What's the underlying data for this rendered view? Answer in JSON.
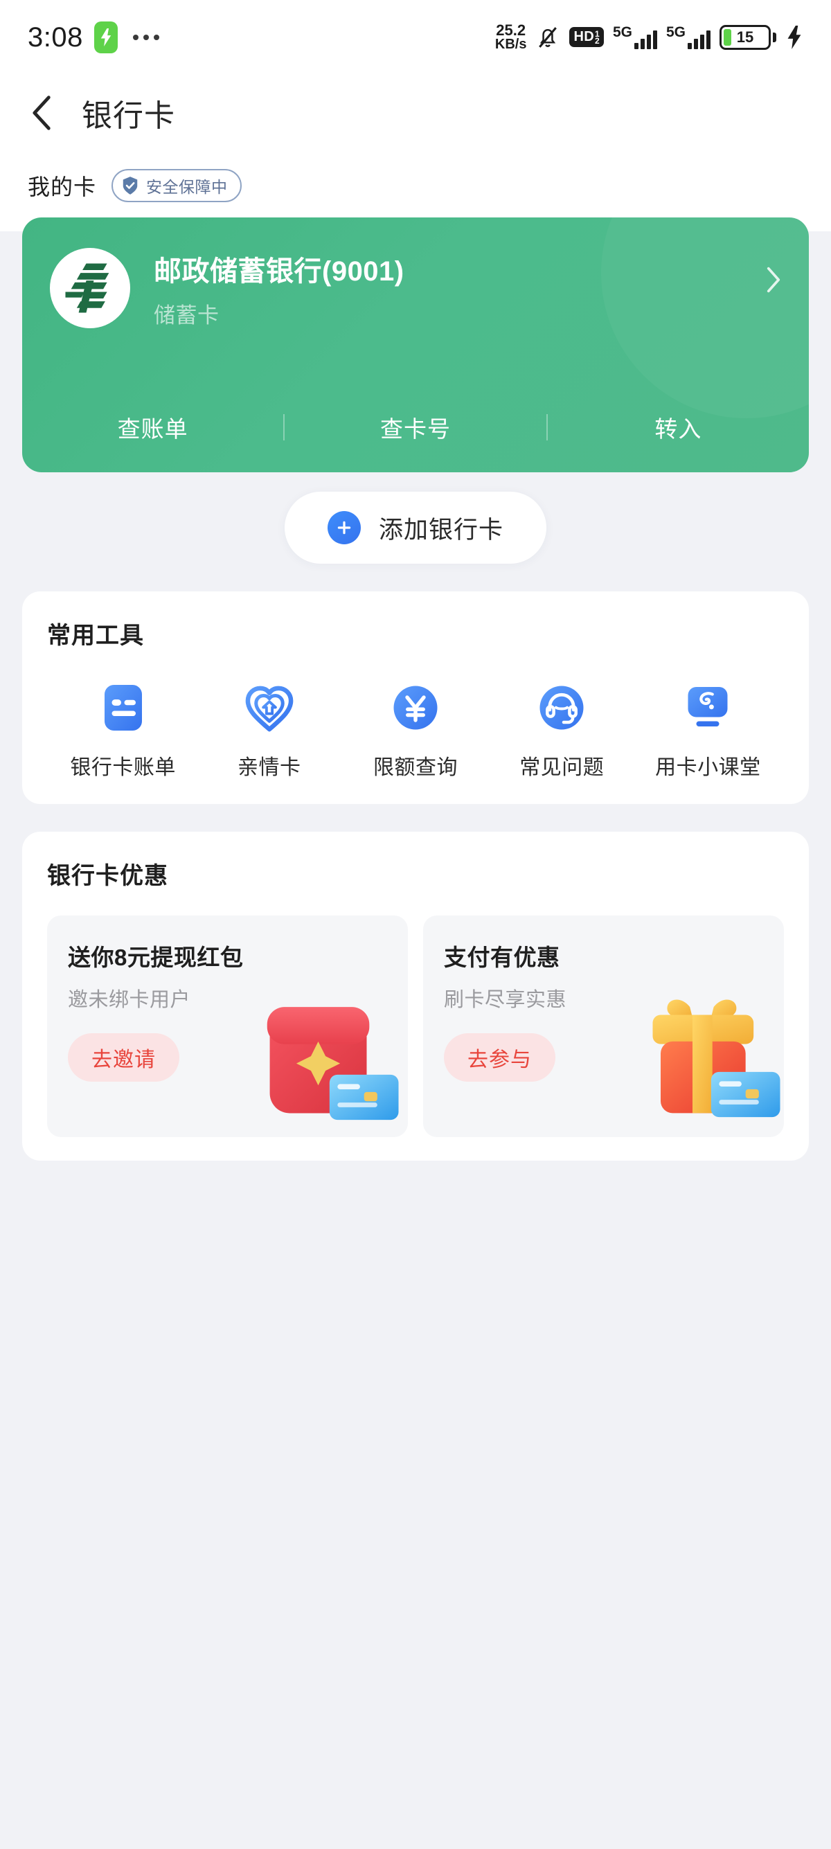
{
  "status_bar": {
    "time": "3:08",
    "charging_icon": "bolt-pill-icon",
    "more_icon": "more-dots-icon",
    "net_speed_value": "25.2",
    "net_speed_unit": "KB/s",
    "mute_icon": "bell-muted-icon",
    "volte_badge": "HD",
    "volte_sub": "1",
    "volte_sub2": "2",
    "sim1_network": "5G",
    "sim2_network": "5G",
    "battery_level": "15",
    "battery_charging_icon": "bolt-icon",
    "battery_color": "#5ed249"
  },
  "nav": {
    "back_icon": "chevron-left-icon",
    "title": "银行卡"
  },
  "my_cards": {
    "title": "我的卡",
    "badge_text": "安全保障中",
    "badge_icon": "shield-check-icon",
    "badge_color": "#5f7296"
  },
  "bank_card": {
    "bank_name": "邮政储蓄银行(9001)",
    "card_type": "储蓄卡",
    "logo_icon": "china-post-savings-bank-logo",
    "chevron_icon": "chevron-right-icon",
    "accent_color": "#4cbb8c",
    "actions": [
      {
        "label": "查账单"
      },
      {
        "label": "查卡号"
      },
      {
        "label": "转入"
      }
    ]
  },
  "add_card": {
    "label": "添加银行卡",
    "icon": "plus-circle-icon",
    "accent_color": "#3573ee"
  },
  "tools": {
    "title": "常用工具",
    "items": [
      {
        "label": "银行卡账单",
        "icon": "bill-list-icon"
      },
      {
        "label": "亲情卡",
        "icon": "family-heart-card-icon"
      },
      {
        "label": "限额查询",
        "icon": "yuan-limit-icon"
      },
      {
        "label": "常见问题",
        "icon": "customer-service-headset-icon"
      },
      {
        "label": "用卡小课堂",
        "icon": "lesson-screen-icon"
      }
    ]
  },
  "offers": {
    "title": "银行卡优惠",
    "items": [
      {
        "title": "送你8元提现红包",
        "subtitle": "邀未绑卡用户",
        "button": "去邀请",
        "art_icon": "red-packet-with-card-icon",
        "button_bg": "#fbe3e4",
        "button_color": "#e8453c"
      },
      {
        "title": "支付有优惠",
        "subtitle": "刷卡尽享实惠",
        "button": "去参与",
        "art_icon": "gift-box-with-card-icon",
        "button_bg": "#fbe3e4",
        "button_color": "#e8453c"
      }
    ]
  }
}
